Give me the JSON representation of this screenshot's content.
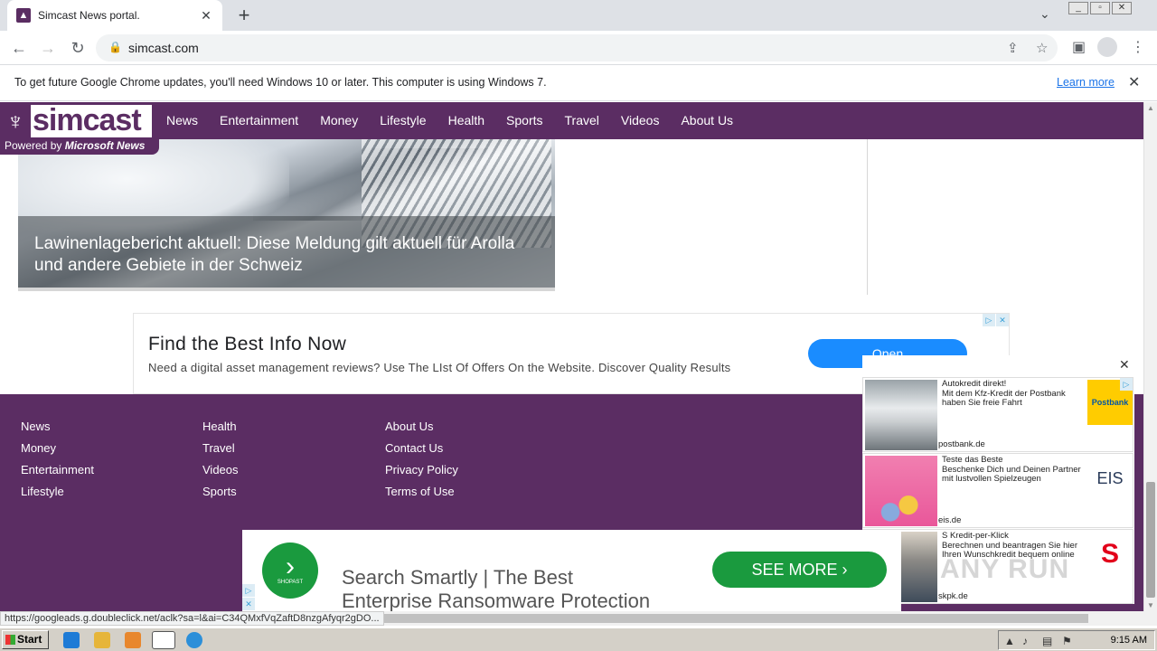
{
  "browser": {
    "tab_title": "Simcast News portal.",
    "url": "simcast.com",
    "infobar_message": "To get future Google Chrome updates, you'll need Windows 10 or later. This computer is using Windows 7.",
    "infobar_link": "Learn more",
    "status_url": "https://googleads.g.doubleclick.net/aclk?sa=l&ai=C34QMxfVqZaftD8nzgAfyqr2gDO..."
  },
  "site": {
    "logo_text": "simcast",
    "powered_by": "Powered by",
    "powered_brand": "Microsoft News",
    "nav": [
      "News",
      "Entertainment",
      "Money",
      "Lifestyle",
      "Health",
      "Sports",
      "Travel",
      "Videos",
      "About Us"
    ]
  },
  "hero": {
    "caption": "Lawinenlagebericht aktuell: Diese Meldung gilt aktuell für Arolla und andere Gebiete in der Schweiz"
  },
  "ad_top": {
    "headline": "Find the Best Info Now",
    "description": "Need a digital asset management reviews? Use The LIst Of Offers On the Website. Discover Quality Results",
    "button": "Open"
  },
  "footer": {
    "col1": [
      "News",
      "Money",
      "Entertainment",
      "Lifestyle"
    ],
    "col2": [
      "Health",
      "Travel",
      "Videos",
      "Sports"
    ],
    "col3": [
      "About Us",
      "Contact Us",
      "Privacy Policy",
      "Terms of Use"
    ]
  },
  "side_ads": [
    {
      "title": "Autokredit direkt!",
      "body": "Mit dem Kfz-Kredit der Postbank haben Sie freie Fahrt",
      "domain": "postbank.de",
      "brand": "Postbank",
      "brand_color": "#ffcc00"
    },
    {
      "title": "Teste das Beste",
      "body": "Beschenke Dich und Deinen Partner mit lustvollen Spielzeugen",
      "domain": "eis.de",
      "brand": "EIS",
      "brand_color": "#ffffff"
    },
    {
      "title": "S Kredit-per-Klick",
      "body": "Berechnen und beantragen Sie hier Ihren Wunschkredit bequem online",
      "domain": "skpk.de",
      "brand": "S",
      "brand_color": "#e2001a"
    }
  ],
  "ad_bottom": {
    "logo_text": "SHOPAST",
    "line1": "Search Smartly | The Best",
    "line2": "Enterprise Ransomware Protection",
    "button": "SEE MORE"
  },
  "watermark": "ANY RUN",
  "taskbar": {
    "start": "Start",
    "clock": "9:15 AM"
  },
  "colors": {
    "brand_purple": "#5b2d63",
    "open_button": "#1a8cff",
    "see_more_button": "#1a9a3e"
  }
}
